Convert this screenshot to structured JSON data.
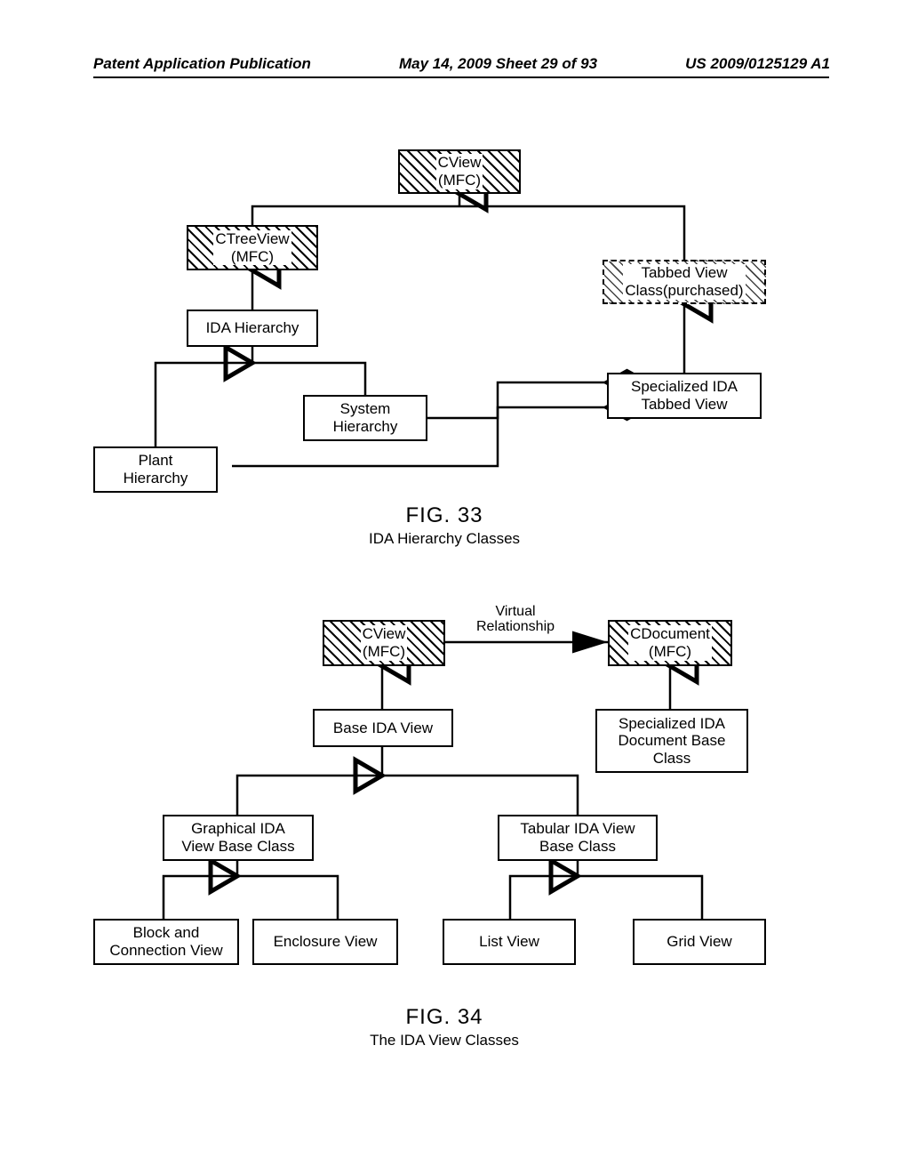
{
  "header": {
    "left": "Patent Application Publication",
    "center": "May 14, 2009  Sheet 29 of 93",
    "right": "US 2009/0125129 A1"
  },
  "fig33": {
    "caption_no": "FIG. 33",
    "caption_title": "IDA Hierarchy Classes",
    "nodes": {
      "cview": "CView\n(MFC)",
      "ctreeview": "CTreeView\n(MFC)",
      "tabbedview": "Tabbed View\nClass(purchased)",
      "idahier": "IDA Hierarchy",
      "systemhier": "System\nHierarchy",
      "planthier": "Plant\nHierarchy",
      "specidatv": "Specialized IDA\nTabbed View"
    }
  },
  "fig34": {
    "caption_no": "FIG. 34",
    "caption_title": "The IDA View Classes",
    "relLabel": "Virtual\nRelationship",
    "nodes": {
      "cview2": "CView\n(MFC)",
      "cdoc": "CDocument\n(MFC)",
      "baseida": "Base IDA View",
      "specdoc": "Specialized IDA\nDocument Base\nClass",
      "graphical": "Graphical IDA\nView Base Class",
      "tabular": "Tabular IDA View\nBase Class",
      "blockconn": "Block and\nConnection View",
      "enclosure": "Enclosure View",
      "listview": "List View",
      "gridview": "Grid View"
    }
  }
}
